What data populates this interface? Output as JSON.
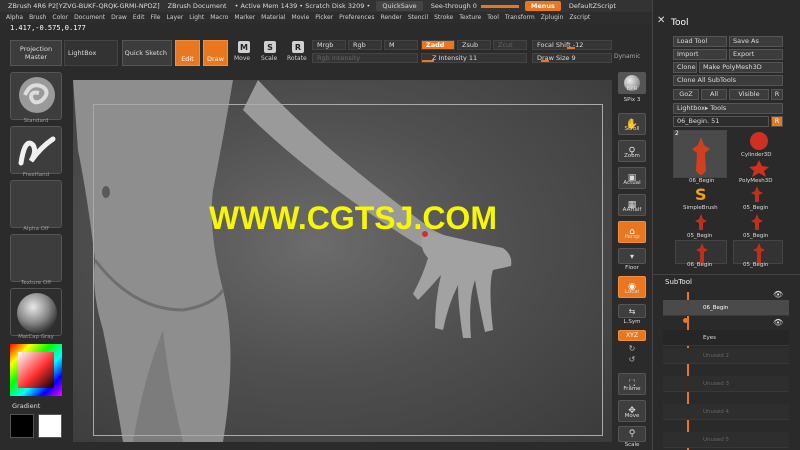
{
  "titlebar": {
    "app": "ZBrush 4R6 P2[YZVG-BUKF-QRQK-GRMI-NPDZ]",
    "document": "ZBrush Document",
    "mem": "• Active Mem 1439 • Scratch Disk 3209 •",
    "quicksave": "QuickSave",
    "seethrough": "See-through  0",
    "menus": "Menus",
    "script": "DefaultZScript"
  },
  "menus": [
    "Alpha",
    "Brush",
    "Color",
    "Document",
    "Draw",
    "Edit",
    "File",
    "Layer",
    "Light",
    "Macro",
    "Marker",
    "Material",
    "Movie",
    "Picker",
    "Preferences",
    "Render",
    "Stencil",
    "Stroke",
    "Texture",
    "Tool",
    "Transform",
    "Zplugin",
    "Zscript"
  ],
  "coords": "1.417,-0.575,0.177",
  "shelf": {
    "projection_master": "Projection Master",
    "lightbox": "LightBox",
    "quick_sketch": "Quick Sketch",
    "edit": "Edit",
    "draw": "Draw",
    "move": "Move",
    "scale": "Scale",
    "rotate": "Rotate",
    "move_glyph": "M",
    "scale_glyph": "S",
    "rotate_glyph": "R",
    "mrgb": "Mrgb",
    "rgb": "Rgb",
    "m": "M",
    "rgb_intensity": "Rgb Intensity",
    "zadd": "Zadd",
    "zsub": "Zsub",
    "zcut": "Zcut",
    "z_intensity": "Z Intensity 11",
    "focal_shift": "Focal Shift -12",
    "draw_size": "Draw Size 9",
    "dynamic": "Dynamic"
  },
  "lefttray": {
    "standard": "Standard",
    "freehand": "FreeHand",
    "alpha_off": "Alpha Off",
    "texture_off": "Texture Off",
    "matcap": "MatCap Gray",
    "gradient": "Gradient"
  },
  "watermark": "WWW.CGTSJ.COM",
  "strip": {
    "bpr": "BPR",
    "spix": "SPix 3",
    "scroll": "Scroll",
    "zoom": "Zoom",
    "actual": "Actual",
    "aahalf": "AAHalf",
    "persp": "Persp",
    "floor": "Floor",
    "local": "Local",
    "lsym": "L.Sym",
    "xyz": "XYZ",
    "frame": "Frame",
    "move": "Move",
    "scale": "Scale"
  },
  "palette": {
    "title": "Tool",
    "load_tool": "Load Tool",
    "save_as": "Save As",
    "import": "Import",
    "export": "Export",
    "clone": "Clone",
    "make_polymesh": "Make PolyMesh3D",
    "clone_all": "Clone All SubTools",
    "goz": "GoZ",
    "all": "All",
    "visible": "Visible",
    "r": "R",
    "lightbox_tools": "Lightbox▸ Tools",
    "current_tool": "06_Begin. 51",
    "r2": "R",
    "tiles": [
      "06_Begin",
      "Cylinder3D",
      "PolyMesh3D",
      "SimpleBrush",
      "05_Begin",
      "05_Begin",
      "05_Begin",
      "06_Begin",
      "05_Begin"
    ],
    "tile_count": "2"
  },
  "subtool": {
    "title": "SubTool",
    "rows": [
      "06_Begin",
      "Eyes",
      "Unused 2",
      "Unused 3",
      "Unused 4",
      "Unused 5"
    ]
  },
  "colors": {
    "accent": "#e8771f",
    "watermark": "#f7f700",
    "panel": "#2b2b2b"
  }
}
